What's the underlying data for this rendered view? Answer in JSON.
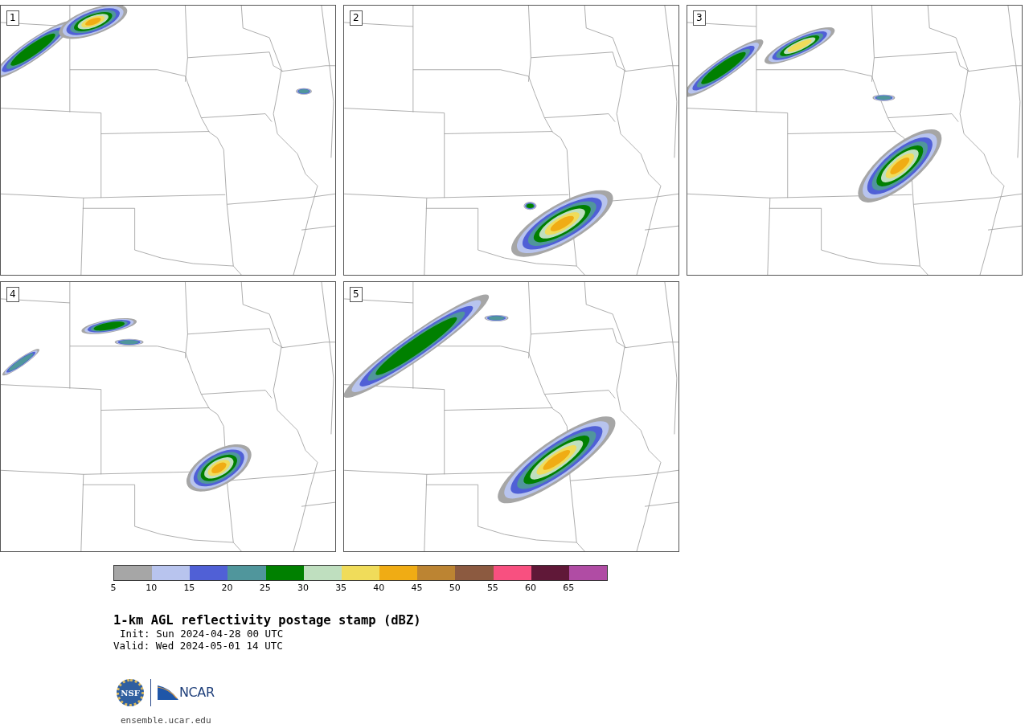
{
  "panels": [
    {
      "label": "1"
    },
    {
      "label": "2"
    },
    {
      "label": "3"
    },
    {
      "label": "4"
    },
    {
      "label": "5"
    }
  ],
  "colorbar": {
    "bins": [
      {
        "color": "#a6a6a6"
      },
      {
        "color": "#b8c4ee"
      },
      {
        "color": "#5060d6"
      },
      {
        "color": "#50969c"
      },
      {
        "color": "#008000"
      },
      {
        "color": "#bfdfbf"
      },
      {
        "color": "#f0dc5a"
      },
      {
        "color": "#f0ac14"
      },
      {
        "color": "#bc8432"
      },
      {
        "color": "#8c5a40"
      },
      {
        "color": "#f85080"
      },
      {
        "color": "#601838"
      },
      {
        "color": "#b04ca4"
      }
    ],
    "ticks": [
      "5",
      "10",
      "15",
      "20",
      "25",
      "30",
      "35",
      "40",
      "45",
      "50",
      "55",
      "60",
      "65"
    ]
  },
  "title": "1-km AGL reflectivity postage stamp (dBZ)",
  "init": "Init: Sun 2024-04-28 00 UTC",
  "valid": "Valid: Wed 2024-05-01 14 UTC",
  "logos": {
    "nsf": "NSF",
    "ncar": "NCAR"
  },
  "footer_link": "ensemble.ucar.edu"
}
